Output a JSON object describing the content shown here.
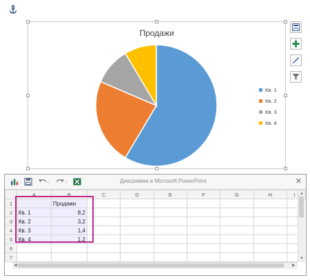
{
  "chart_data": {
    "type": "pie",
    "title": "Продажи",
    "categories": [
      "Кв. 1",
      "Кв. 2",
      "Кв. 3",
      "Кв. 4"
    ],
    "values": [
      8.2,
      3.2,
      1.4,
      1.2
    ],
    "colors": [
      "#5b9bd5",
      "#ed7d31",
      "#a5a5a5",
      "#ffc000"
    ],
    "legend_position": "right"
  },
  "sheet": {
    "window_title": "Диаграмма в Microsoft PowerPoint",
    "columns": [
      "A",
      "B",
      "C",
      "D",
      "E",
      "F",
      "G",
      "H",
      "I"
    ],
    "rows": [
      {
        "num": "1",
        "a": "",
        "b": "Продажи"
      },
      {
        "num": "2",
        "a": "Кв. 1",
        "b": "8,2"
      },
      {
        "num": "3",
        "a": "Кв. 2",
        "b": "3,2"
      },
      {
        "num": "4",
        "a": "Кв. 3",
        "b": "1,4"
      },
      {
        "num": "5",
        "a": "Кв. 4",
        "b": "1,2"
      },
      {
        "num": "6",
        "a": "",
        "b": ""
      },
      {
        "num": "7",
        "a": "",
        "b": ""
      }
    ],
    "close_symbol": "✕"
  },
  "icons": {
    "anchor": "anchor-icon",
    "toolbar": [
      "chart-layout-icon",
      "chart-elements-icon",
      "chart-styles-icon",
      "chart-filters-icon"
    ],
    "sheet_toolbar": [
      "chart-icon",
      "save-icon",
      "undo-icon",
      "redo-icon",
      "excel-icon"
    ]
  }
}
